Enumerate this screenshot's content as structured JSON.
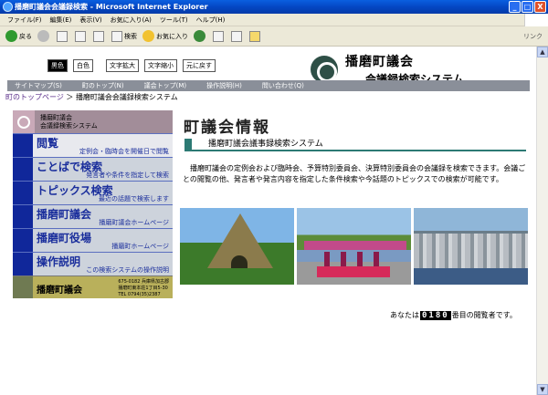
{
  "window": {
    "title": "播磨町議会会議録検索 - Microsoft Internet Explorer",
    "buttons": {
      "minimize": "_",
      "maximize": "□",
      "close": "X"
    }
  },
  "menubar": {
    "items": [
      "ファイル(F)",
      "編集(E)",
      "表示(V)",
      "お気に入り(A)",
      "ツール(T)",
      "ヘルプ(H)"
    ]
  },
  "toolbar": {
    "back": "戻る",
    "search": "検索",
    "favorites": "お気に入り",
    "links": "リンク"
  },
  "accessibility": {
    "black": "黒色",
    "white": "白色",
    "enlarge": "文字拡大",
    "shrink": "文字縮小",
    "reset": "元に戻す"
  },
  "logo": {
    "line1": "播磨町議会",
    "line2": "会議録検索システム"
  },
  "navbar": {
    "items": [
      "サイトマップ(S)",
      "町のトップ(N)",
      "議会トップ(M)",
      "操作説明(H)",
      "問い合わせ(Q)"
    ]
  },
  "breadcrumb": {
    "link": "町のトップページ",
    "separator": "＞",
    "current": "播磨町議会会議録検索システム"
  },
  "leftmenu": {
    "head": {
      "line1": "播磨町議会",
      "line2": "会議録検索システム"
    },
    "items": [
      {
        "big": "閲覧",
        "small": "定例会・臨時会を開催日で閲覧"
      },
      {
        "big": "ことばで検索",
        "small": "発言者や条件を指定して検索"
      },
      {
        "big": "トピックス検索",
        "small": "最近の話題で検索します"
      },
      {
        "big": "播磨町議会",
        "small": "播磨町議会ホームページ"
      },
      {
        "big": "播磨町役場",
        "small": "播磨町ホームページ"
      },
      {
        "big": "操作説明",
        "small": "この検索システムの操作説明"
      }
    ],
    "footer": {
      "name": "播磨町議会",
      "addr1": "675-0182 兵庫県加古郡",
      "addr2": "播磨町東本荘1丁目5-30",
      "tel": "TEL 0794(35)2387"
    }
  },
  "main": {
    "title": "町議会情報",
    "subhead": "播磨町議会議事録検索システム",
    "description": "播磨町議会の定例会および臨時会、予算特別委員会、決算特別委員会の会議録を検索できます。会議ごとの閲覧の他、発言者や発言内容を指定した条件検索や今話題のトピックスでの検索が可能です。"
  },
  "counter": {
    "prefix": "あなたは",
    "number": "0180",
    "suffix": "番目の閲覧者です。"
  }
}
